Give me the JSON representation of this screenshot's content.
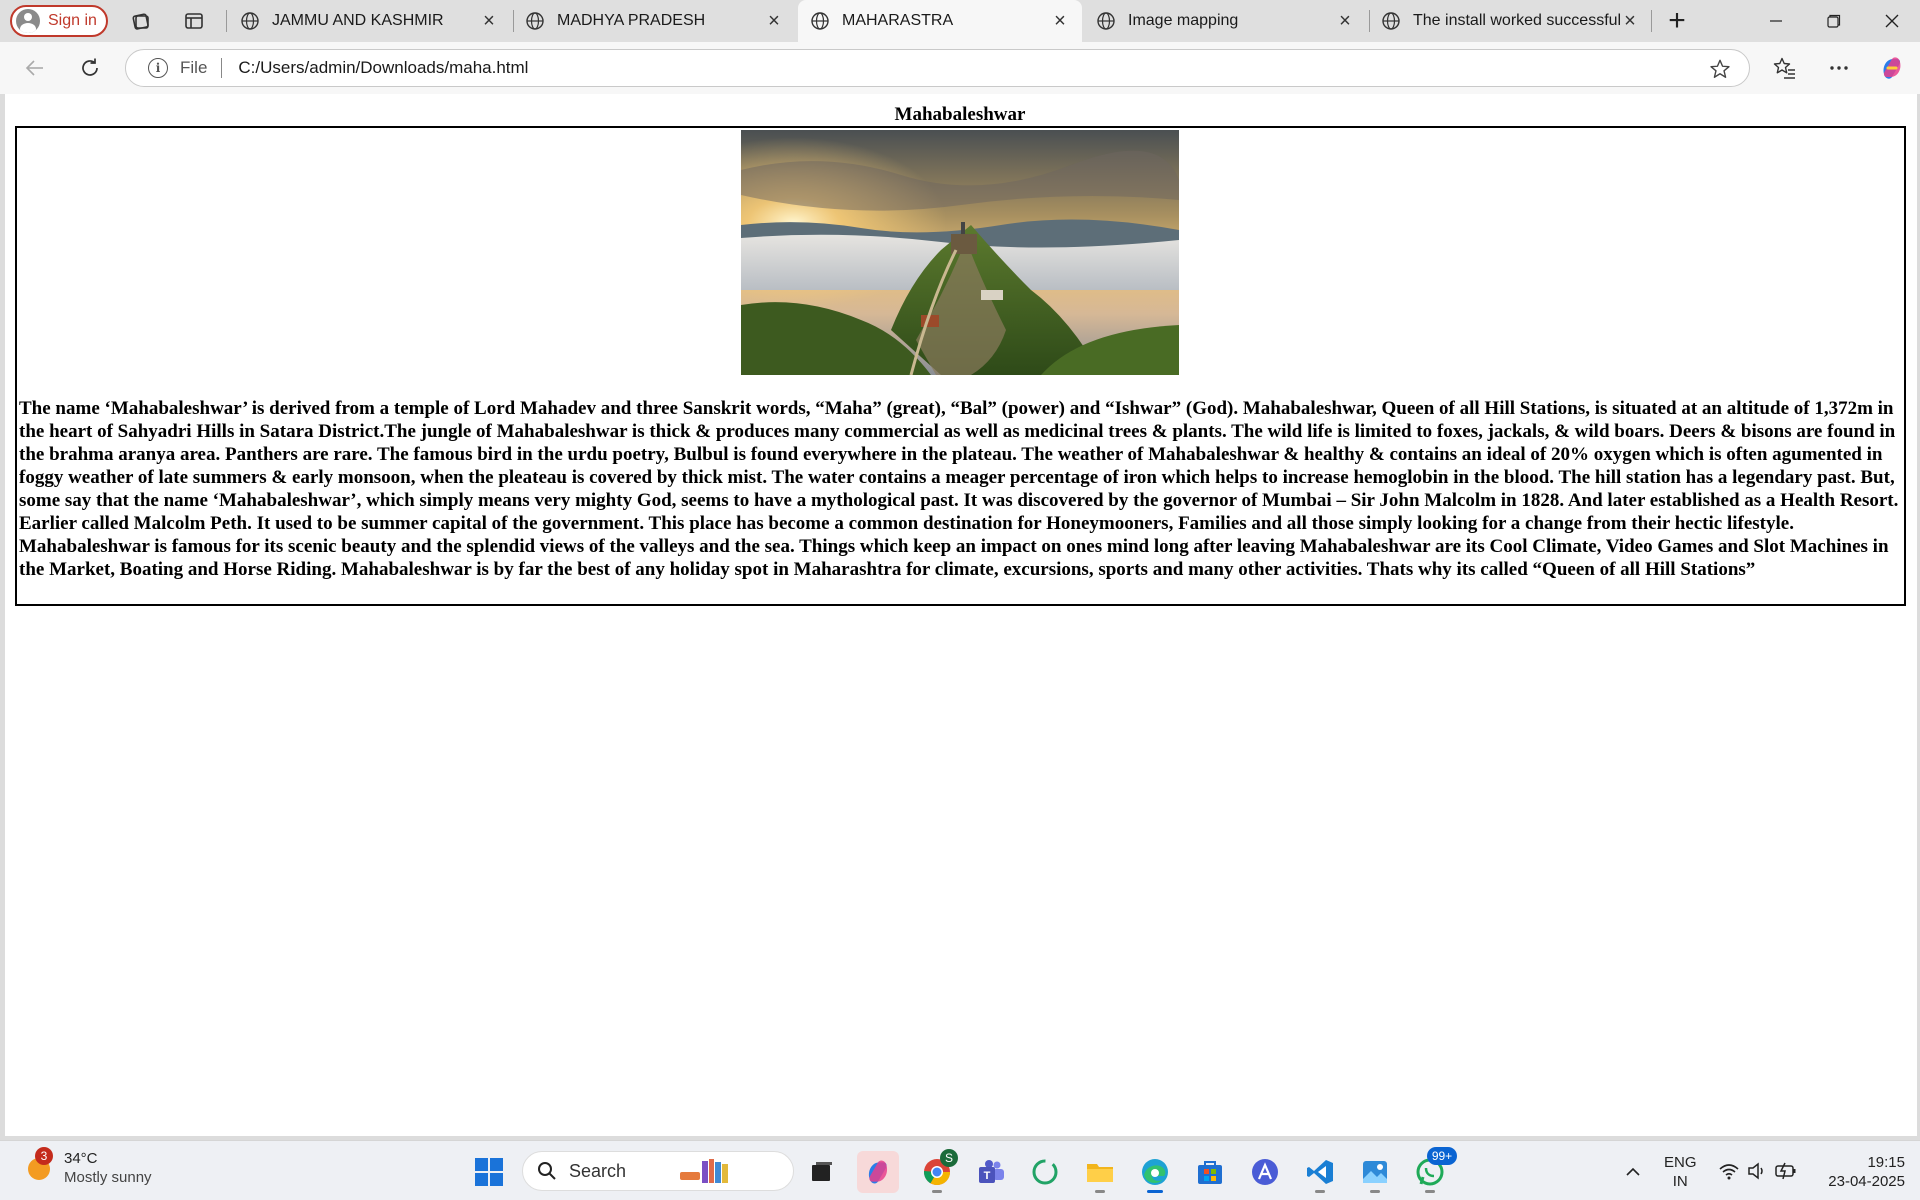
{
  "browser": {
    "signin_label": "Sign in",
    "tabs": [
      {
        "title": "JAMMU AND KASHMIR"
      },
      {
        "title": "MADHYA PRADESH"
      },
      {
        "title": "MAHARASTRA"
      },
      {
        "title": "Image mapping"
      },
      {
        "title": "The install worked successfully!"
      }
    ],
    "address": {
      "scheme": "File",
      "url": "C:/Users/admin/Downloads/maha.html"
    }
  },
  "page": {
    "heading": "Mahabaleshwar",
    "image_alt": "Mahabaleshwar hill fort at sunrise above clouds",
    "body_text": "The name ‘Mahabaleshwar’ is derived from a temple of Lord Mahadev and three Sanskrit words, “Maha” (great), “Bal” (power) and “Ishwar” (God). Mahabaleshwar, Queen of all Hill Stations, is situated at an altitude of 1,372m in the heart of Sahyadri Hills in Satara District.The jungle of Mahabaleshwar is thick & produces many commercial as well as medicinal trees & plants. The wild life is limited to foxes, jackals, & wild boars. Deers & bisons are found in the brahma aranya area. Panthers are rare. The famous bird in the urdu poetry, Bulbul is found everywhere in the plateau. The weather of Mahabaleshwar & healthy & contains an ideal of 20% oxygen which is often agumented in foggy weather of late summers & early monsoon, when the pleateau is covered by thick mist. The water contains a meager percentage of iron which helps to increase hemoglobin in the blood. The hill station has a legendary past. But, some say that the name ‘Mahabaleshwar’, which simply means very mighty God, seems to have a mythological past. It was discovered by the governor of Mumbai – Sir John Malcolm in 1828. And later established as a Health Resort. Earlier called Malcolm Peth. It used to be summer capital of the government. This place has become a common destination for Honeymooners, Families and all those simply looking for a change from their hectic lifestyle. Mahabaleshwar is famous for its scenic beauty and the splendid views of the valleys and the sea. Things which keep an impact on ones mind long after leaving Mahabaleshwar are its Cool Climate, Video Games and Slot Machines in the Market, Boating and Horse Riding. Mahabaleshwar is by far the best of any holiday spot in Maharashtra for climate, excursions, sports and many other activities. Thats why its called “Queen of all Hill Stations”"
  },
  "taskbar": {
    "weather": {
      "badge": "3",
      "temp": "34°C",
      "desc": "Mostly sunny"
    },
    "search_label": "Search",
    "chrome_badge": "S",
    "whatsapp_badge": "99+",
    "lang_top": "ENG",
    "lang_bottom": "IN",
    "time": "19:15",
    "date": "23-04-2025"
  },
  "colors": {
    "accent": "#0a64d2",
    "signin": "#c0392b",
    "badge": "#c42b1c"
  }
}
